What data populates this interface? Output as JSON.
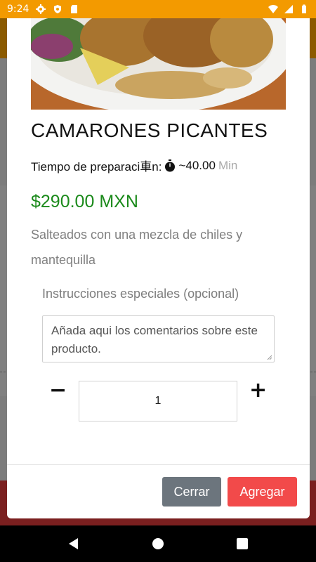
{
  "status_bar": {
    "time": "9:24",
    "left_icons": [
      "settings-icon",
      "shield-icon",
      "sd-card-icon"
    ],
    "right_icons": [
      "wifi-icon",
      "signal-icon",
      "battery-icon"
    ]
  },
  "modal": {
    "title": "CAMARONES PICANTES",
    "prep_label": "Tiempo de preparaci車n:",
    "prep_value": "~40.00",
    "prep_unit": "Min",
    "price": "$290.00 MXN",
    "description": "Salteados con una mezcla de chiles y mantequilla",
    "instructions_label": "Instrucciones especiales (opcional)",
    "instructions_placeholder": "Añada aqui los comentarios sobre este producto.",
    "quantity": "1",
    "minus_label": "−",
    "plus_label": "+",
    "close_label": "Cerrar",
    "add_label": "Agregar"
  },
  "colors": {
    "status_bar": "#f39a00",
    "price": "#1b8a1b",
    "close_button": "#6c757d",
    "add_button": "#f24a4a"
  },
  "nav_bar": {
    "icons": [
      "back-icon",
      "home-icon",
      "recents-icon"
    ]
  }
}
